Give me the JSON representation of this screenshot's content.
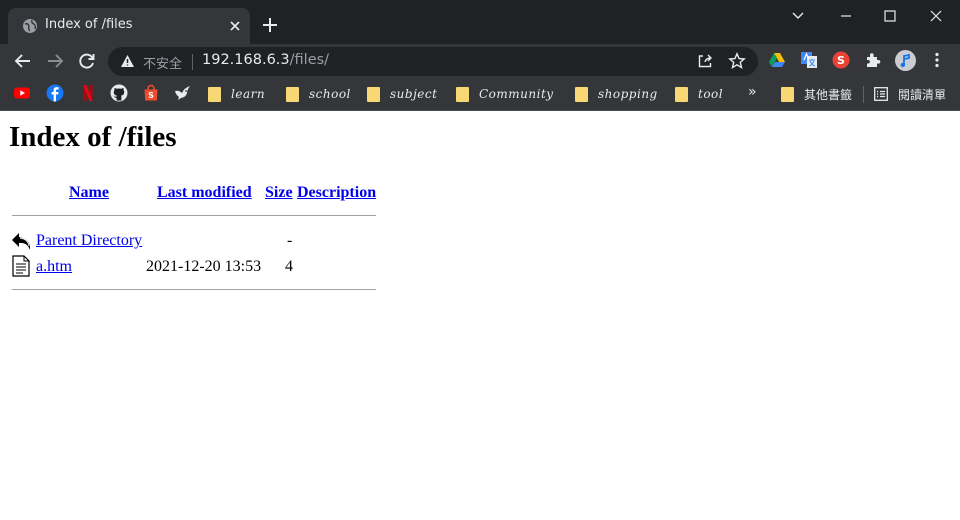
{
  "browser": {
    "tab_title": "Index of /files",
    "address": {
      "insecure_label": "不安全",
      "host": "192.168.6.3",
      "path": "/files/"
    },
    "bookmarks": [
      {
        "icon": "youtube-icon"
      },
      {
        "icon": "facebook-icon"
      },
      {
        "icon": "netflix-icon"
      },
      {
        "icon": "github-icon"
      },
      {
        "icon": "shopee-icon"
      },
      {
        "icon": "bird-icon"
      }
    ],
    "bookmark_folders": [
      "learn",
      "school",
      "subject",
      "Community",
      "shopping",
      "tool"
    ],
    "more_chevron": "»",
    "other_bookmarks": "其他書籤",
    "reading_list": "閱讀清單",
    "colors": {
      "frame": "#202124",
      "toolbar": "#35363a",
      "folder": "#f8d775"
    }
  },
  "page": {
    "heading": "Index of /files",
    "columns": {
      "name": "Name",
      "last_modified": "Last modified",
      "size": "Size",
      "description": "Description"
    },
    "rows": [
      {
        "icon": "back-arrow-icon",
        "name": "Parent Directory",
        "modified": "",
        "size": "-",
        "description": ""
      },
      {
        "icon": "text-file-icon",
        "name": "a.htm",
        "modified": "2021-12-20 13:53",
        "size": "4",
        "description": ""
      }
    ]
  }
}
